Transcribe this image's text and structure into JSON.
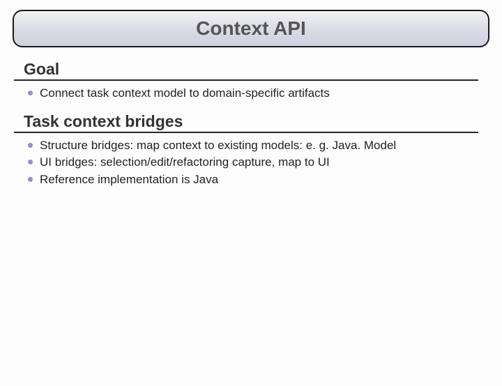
{
  "title": "Context API",
  "sections": [
    {
      "heading": "Goal",
      "items": [
        "Connect task context model to domain-specific artifacts"
      ]
    },
    {
      "heading": "Task context bridges",
      "items": [
        "Structure bridges: map context to existing models: e. g. Java. Model",
        "UI bridges: selection/edit/refactoring capture, map to UI",
        "Reference implementation is Java"
      ]
    }
  ]
}
